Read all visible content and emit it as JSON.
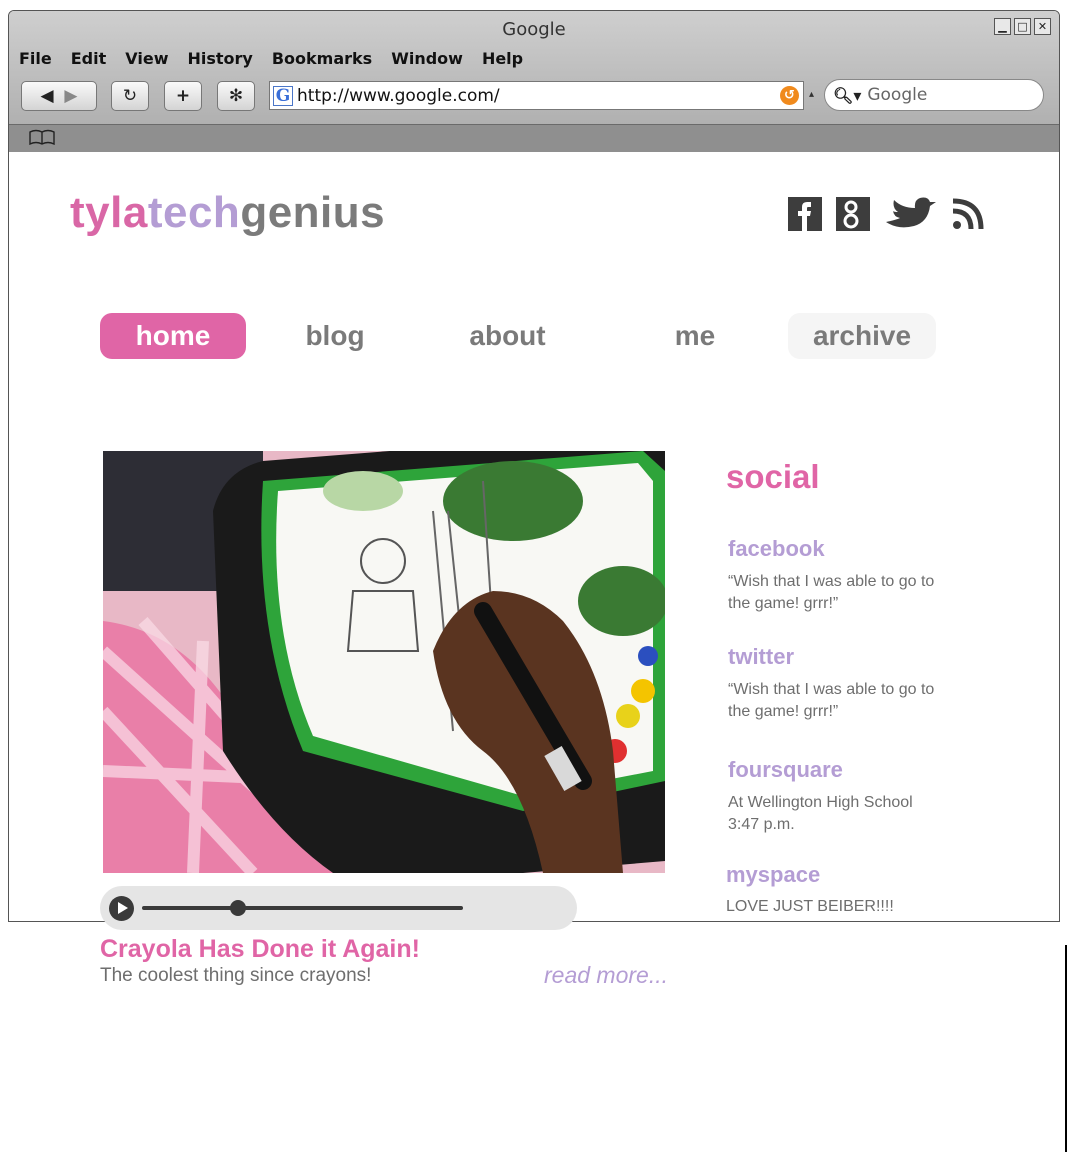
{
  "browser": {
    "title": "Google",
    "menu": [
      "File",
      "Edit",
      "View",
      "History",
      "Bookmarks",
      "Window",
      "Help"
    ],
    "url": "http://www.google.com/",
    "search_placeholder": "Google"
  },
  "site": {
    "logo": {
      "part1": "tyla",
      "part2": "tech",
      "part3": "genius"
    },
    "social_icons": [
      "facebook-icon",
      "google-plus-icon",
      "twitter-icon",
      "rss-icon"
    ],
    "nav": [
      "home",
      "blog",
      "about",
      "me",
      "archive"
    ],
    "active_nav": "home"
  },
  "post": {
    "title": "Crayola Has Done it Again!",
    "subtitle": "The coolest thing since crayons!",
    "read_more": "read more...",
    "audio_progress": 0.3
  },
  "sidebar": {
    "title": "social",
    "items": [
      {
        "name": "facebook",
        "lines": [
          "“Wish that I was able to go to",
          "the game! grrr!”"
        ]
      },
      {
        "name": "twitter",
        "lines": [
          "“Wish that I was able to go to",
          "the game! grrr!”"
        ]
      },
      {
        "name": "foursquare",
        "lines": [
          "At Wellington High School",
          "3:47 p.m."
        ]
      },
      {
        "name": "myspace",
        "lines": [
          "LOVE JUST BEIBER!!!!"
        ]
      }
    ]
  },
  "colors": {
    "pink": "#e065a6",
    "lavender": "#b49dd4",
    "gray": "#7b7b7b"
  }
}
